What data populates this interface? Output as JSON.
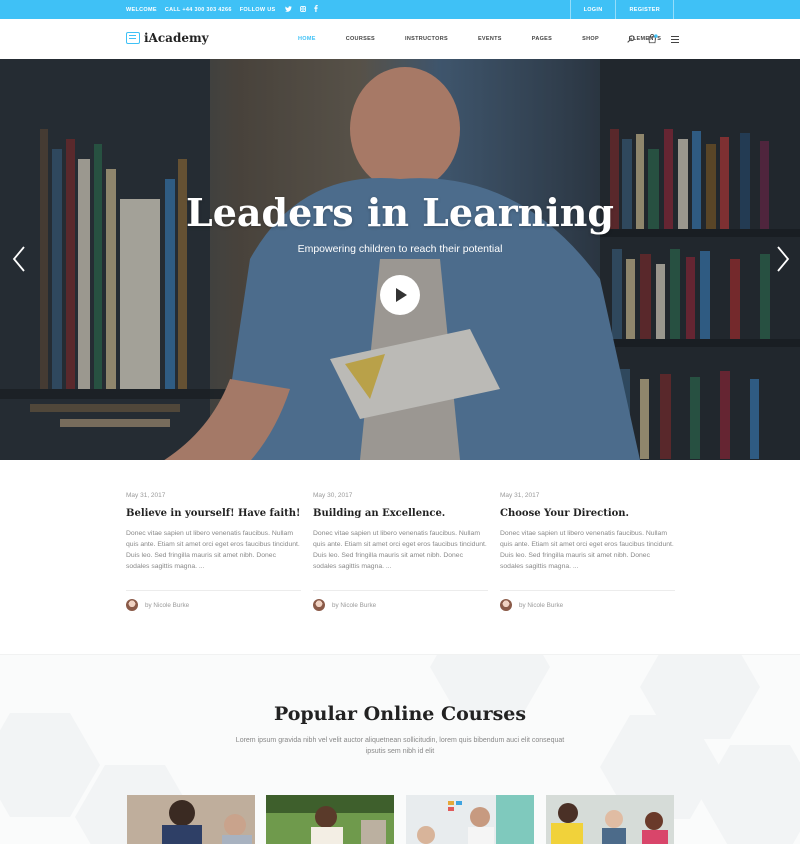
{
  "topbar": {
    "welcome": "WELCOME",
    "phone": "CALL +44 300 303 4266",
    "follow": "FOLLOW US",
    "social_icons": [
      "twitter-icon",
      "instagram-icon",
      "facebook-icon"
    ],
    "login": "LOGIN",
    "register": "REGISTER"
  },
  "header": {
    "logo_text": "iAcademy",
    "nav": [
      "HOME",
      "COURSES",
      "INSTRUCTORS",
      "EVENTS",
      "PAGES",
      "SHOP",
      "ELEMENTS"
    ],
    "active_nav": "HOME",
    "icons": [
      "search-icon",
      "cart-icon",
      "menu-icon"
    ]
  },
  "hero": {
    "title": "Leaders in Learning",
    "subtitle": "Empowering children to reach their potential"
  },
  "posts": [
    {
      "date": "May 31, 2017",
      "title": "Believe in yourself! Have faith!",
      "excerpt": "Donec vitae sapien ut libero venenatis faucibus. Nullam quis ante. Etiam sit amet orci eget eros faucibus tincidunt. Duis leo. Sed fringilla mauris sit amet nibh. Donec sodales sagittis magna. ...",
      "author": "by Nicole Burke"
    },
    {
      "date": "May 30, 2017",
      "title": "Building an Excellence.",
      "excerpt": "Donec vitae sapien ut libero venenatis faucibus. Nullam quis ante. Etiam sit amet orci eget eros faucibus tincidunt. Duis leo. Sed fringilla mauris sit amet nibh. Donec sodales sagittis magna. ...",
      "author": "by Nicole Burke"
    },
    {
      "date": "May 31, 2017",
      "title": "Choose Your Direction.",
      "excerpt": "Donec vitae sapien ut libero venenatis faucibus. Nullam quis ante. Etiam sit amet orci eget eros faucibus tincidunt. Duis leo. Sed fringilla mauris sit amet nibh. Donec sodales sagittis magna. ...",
      "author": "by Nicole Burke"
    }
  ],
  "courses": {
    "title": "Popular Online Courses",
    "subtitle": "Lorem ipsum gravida nibh vel velit auctor aliquetnean sollicitudin, lorem quis bibendum auci elit consequat ipsutis sem nibh id elit"
  },
  "colors": {
    "accent": "#3fc1f6",
    "text_dark": "#222222",
    "text_muted": "#888888"
  }
}
